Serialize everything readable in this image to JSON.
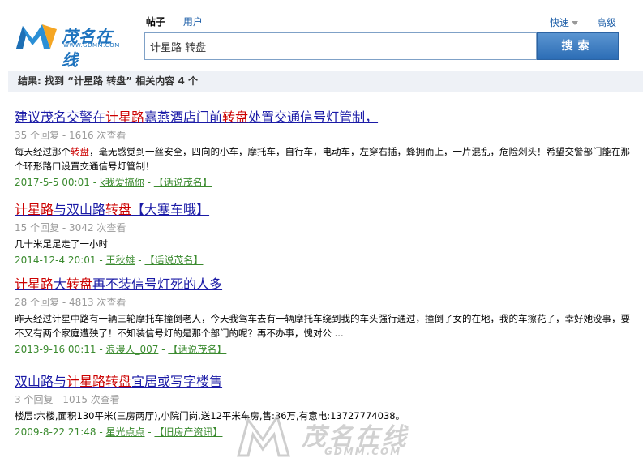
{
  "logo": {
    "text": "茂名在线",
    "subtext": "WWW.GDMM.COM"
  },
  "search": {
    "tabs": [
      {
        "label": "帖子",
        "active": true
      },
      {
        "label": "用户",
        "active": false
      }
    ],
    "quick_label": "快速",
    "advanced_label": "高级",
    "query": "计星路 转盘",
    "button_label": "搜索"
  },
  "result_summary": "结果: 找到 “计星路 转盘” 相关内容 4 个",
  "results": [
    {
      "title_parts": [
        "建议茂名交警在",
        "计星路",
        "嘉燕酒店门前",
        "转盘",
        "处置交通信号灯管制，"
      ],
      "stats": "35 个回复 - 1616 次查看",
      "desc_parts": [
        "每天经过那个",
        "转盘",
        "，毫无感觉到一丝安全，四向的小车，摩托车，自行车，电动车，左穿右插，蜂拥而上，一片混乱，危险剁头！希望交警部门能在那个环形路口设置交通信号灯管制！"
      ],
      "date": "2017-5-5 00:01",
      "author": "k我爱搞你",
      "forum": "【话说茂名】"
    },
    {
      "title_parts": [
        "计星路",
        "与双山路",
        "转盘",
        "【大塞车哦】"
      ],
      "stats": "15 个回复 - 3042 次查看",
      "desc_parts": [
        "几十米足足走了一小时"
      ],
      "date": "2014-12-4 20:01",
      "author": "王秋雄",
      "forum": "【话说茂名】"
    },
    {
      "title_parts": [
        "计星路",
        "大",
        "转盘",
        "再不装信号灯死的人多"
      ],
      "stats": "28 个回复 - 4813 次查看",
      "desc_parts": [
        "昨天经过计星中路有一辆三轮摩托车撞倒老人，今天我驾车去有一辆摩托车绕到我的车头强行通过，撞倒了女的在地，我的车擦花了，幸好她没事，要不又有两个家庭遭殃了！不知装信号灯的是那个部门的呢？再不办事，愧对公 ..."
      ],
      "date": "2013-9-16 00:11",
      "author": "浪漫人_007",
      "forum": "【话说茂名】"
    },
    {
      "title_parts": [
        "双山路与",
        "计星路",
        "转盘",
        "宜居或写字楼售"
      ],
      "stats": "3 个回复 - 1015 次查看",
      "desc_parts": [
        "楼层:六楼,面积130平米(三房两厅),小院门岗,送12平米车房,售:36万,有意电:13727774038。"
      ],
      "date": "2009-8-22 21:48",
      "author": "星光点点",
      "forum": "【旧房产资讯】"
    }
  ],
  "watermark": {
    "text": "茂名在线",
    "subtext": "GDMM.COM"
  },
  "colors": {
    "highlight": "#cc0000",
    "link": "#1a1aa6",
    "meta": "#3a8a2e",
    "button": "#2c6db5"
  }
}
